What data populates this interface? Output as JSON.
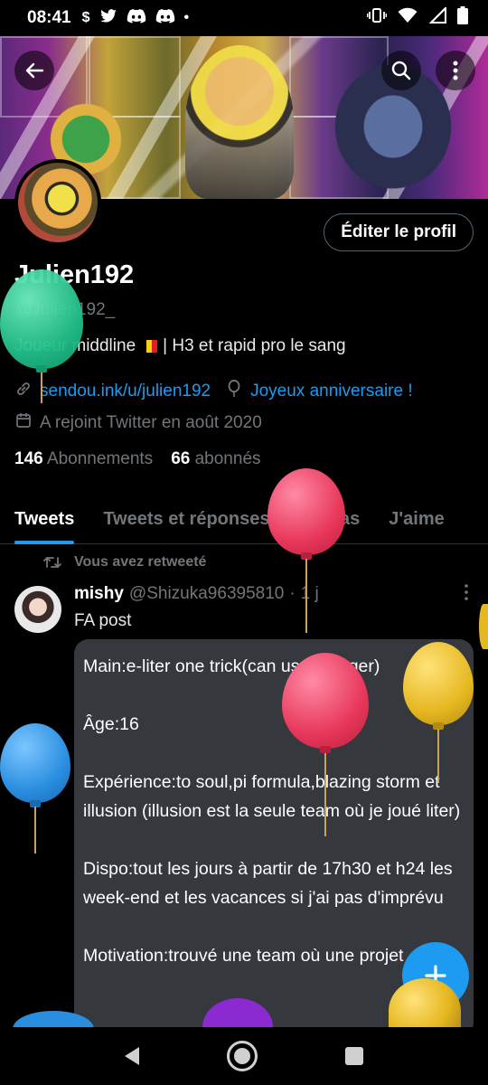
{
  "status_bar": {
    "time": "08:41",
    "left_icons": [
      "dollar-icon",
      "twitter-bird-icon",
      "discord-icon",
      "discord-icon",
      "dot-icon"
    ],
    "right_icons": [
      "vibrate-icon",
      "wifi-icon",
      "signal-icon",
      "battery-icon"
    ]
  },
  "profile": {
    "display_name": "Julien192",
    "handle": "@Julien192_",
    "bio_before": "Joueur middline",
    "bio_after": "| H3 et rapid pro le sang",
    "website": "sendou.ink/u/julien192",
    "birthday": "Joyeux anniversaire !",
    "joined": "A rejoint Twitter en août 2020",
    "following_count": "146",
    "following_label": "Abonnements",
    "followers_count": "66",
    "followers_label": "abonnés",
    "edit_button": "Éditer le profil"
  },
  "tabs": [
    {
      "label": "Tweets",
      "active": true
    },
    {
      "label": "Tweets et réponses",
      "active": false
    },
    {
      "label": "Médias",
      "active": false
    },
    {
      "label": "J'aime",
      "active": false
    }
  ],
  "tweet": {
    "retweet_label": "Vous avez retweeté",
    "author": "mishy",
    "author_handle": "@Shizuka96395810",
    "separator": "·",
    "time": "1 j",
    "text": "FA post",
    "card_lines": [
      "Main:e-liter one trick(can use charger)",
      "Âge:16",
      "Expérience:to soul,pi formula,blazing storm et illusion (illusion est la seule team où je joué liter)",
      "Dispo:tout les jours à partir de 17h30 et h24 les week-end et les vacances si j'ai pas d'imprévu",
      "Motivation:trouvé une team où une projet"
    ]
  },
  "colors": {
    "accent": "#1d9bf0",
    "muted": "#71767b",
    "balloon_green": "#22c08a",
    "balloon_red": "#e8375a",
    "balloon_yellow": "#e6b820",
    "balloon_blue": "#2a8ee0",
    "balloon_purple": "#8a2ad0"
  }
}
